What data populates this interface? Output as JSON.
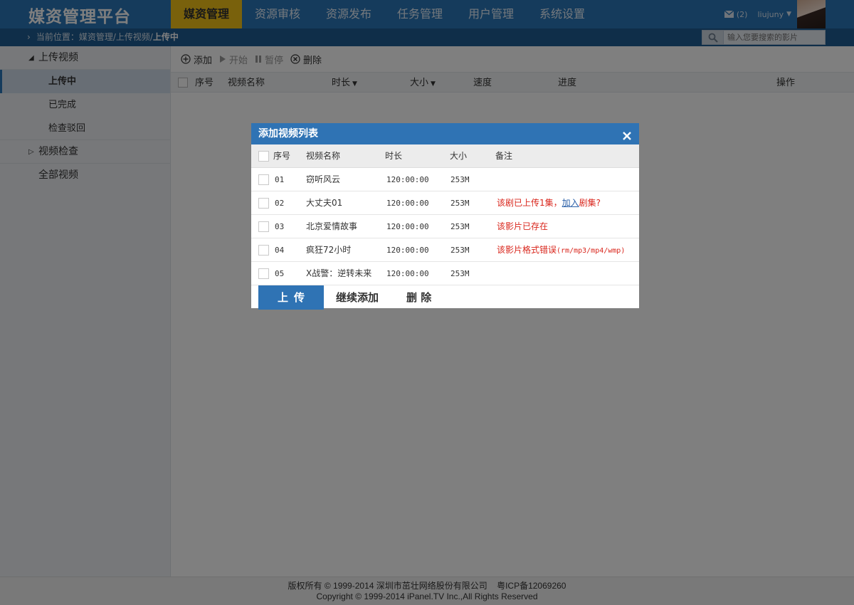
{
  "header": {
    "logo": "媒资管理平台",
    "nav": [
      "媒资管理",
      "资源审核",
      "资源发布",
      "任务管理",
      "用户管理",
      "系统设置"
    ],
    "active_nav": "媒资管理",
    "mail_count": "(2)",
    "username": "liujuny",
    "brand_color": "#2a76b8",
    "active_color": "#f2c218"
  },
  "breadcrumb": {
    "prefix": "当前位置：媒资管理/上传视频/",
    "current": "上传中"
  },
  "search": {
    "placeholder": "输入您要搜索的影片"
  },
  "sidebar": {
    "group_upload": "上传视频",
    "sub_items": [
      "上传中",
      "已完成",
      "检查驳回"
    ],
    "group_check": "视频检查",
    "all_videos": "全部视频"
  },
  "toolbar": {
    "add": "添加",
    "start": "开始",
    "pause": "暂停",
    "delete": "删除"
  },
  "table": {
    "headers": {
      "index": "序号",
      "name": "视频名称",
      "duration": "时长",
      "size": "大小",
      "speed": "速度",
      "progress": "进度",
      "action": "操作"
    }
  },
  "modal": {
    "title": "添加视频列表",
    "headers": {
      "index": "序号",
      "name": "视频名称",
      "duration": "时长",
      "size": "大小",
      "note": "备注"
    },
    "rows": [
      {
        "index": "01",
        "name": "窃听风云",
        "duration": "120:00:00",
        "size": "253M",
        "note": ""
      },
      {
        "index": "02",
        "name": "大丈夫01",
        "duration": "120:00:00",
        "size": "253M",
        "note_pre": "该剧已上传1集，",
        "note_link": "加入",
        "note_post": "剧集?"
      },
      {
        "index": "03",
        "name": "北京爱情故事",
        "duration": "120:00:00",
        "size": "253M",
        "note": "该影片已存在"
      },
      {
        "index": "04",
        "name": "疯狂72小时",
        "duration": "120:00:00",
        "size": "253M",
        "note_pre": "该影片格式错误",
        "note_mono": "(rm/mp3/mp4/wmp)"
      },
      {
        "index": "05",
        "name": "X战警：逆转未来",
        "duration": "120:00:00",
        "size": "253M",
        "note": ""
      }
    ],
    "buttons": {
      "upload": "上传",
      "continue": "继续添加",
      "delete": "删 除"
    }
  },
  "footer": {
    "line1": "版权所有 © 1999-2014 深圳市茁壮网络股份有限公司    粤ICP备12069260",
    "line2": "Copyright © 1999-2014 iPanel.TV Inc.,All Rights Reserved"
  }
}
